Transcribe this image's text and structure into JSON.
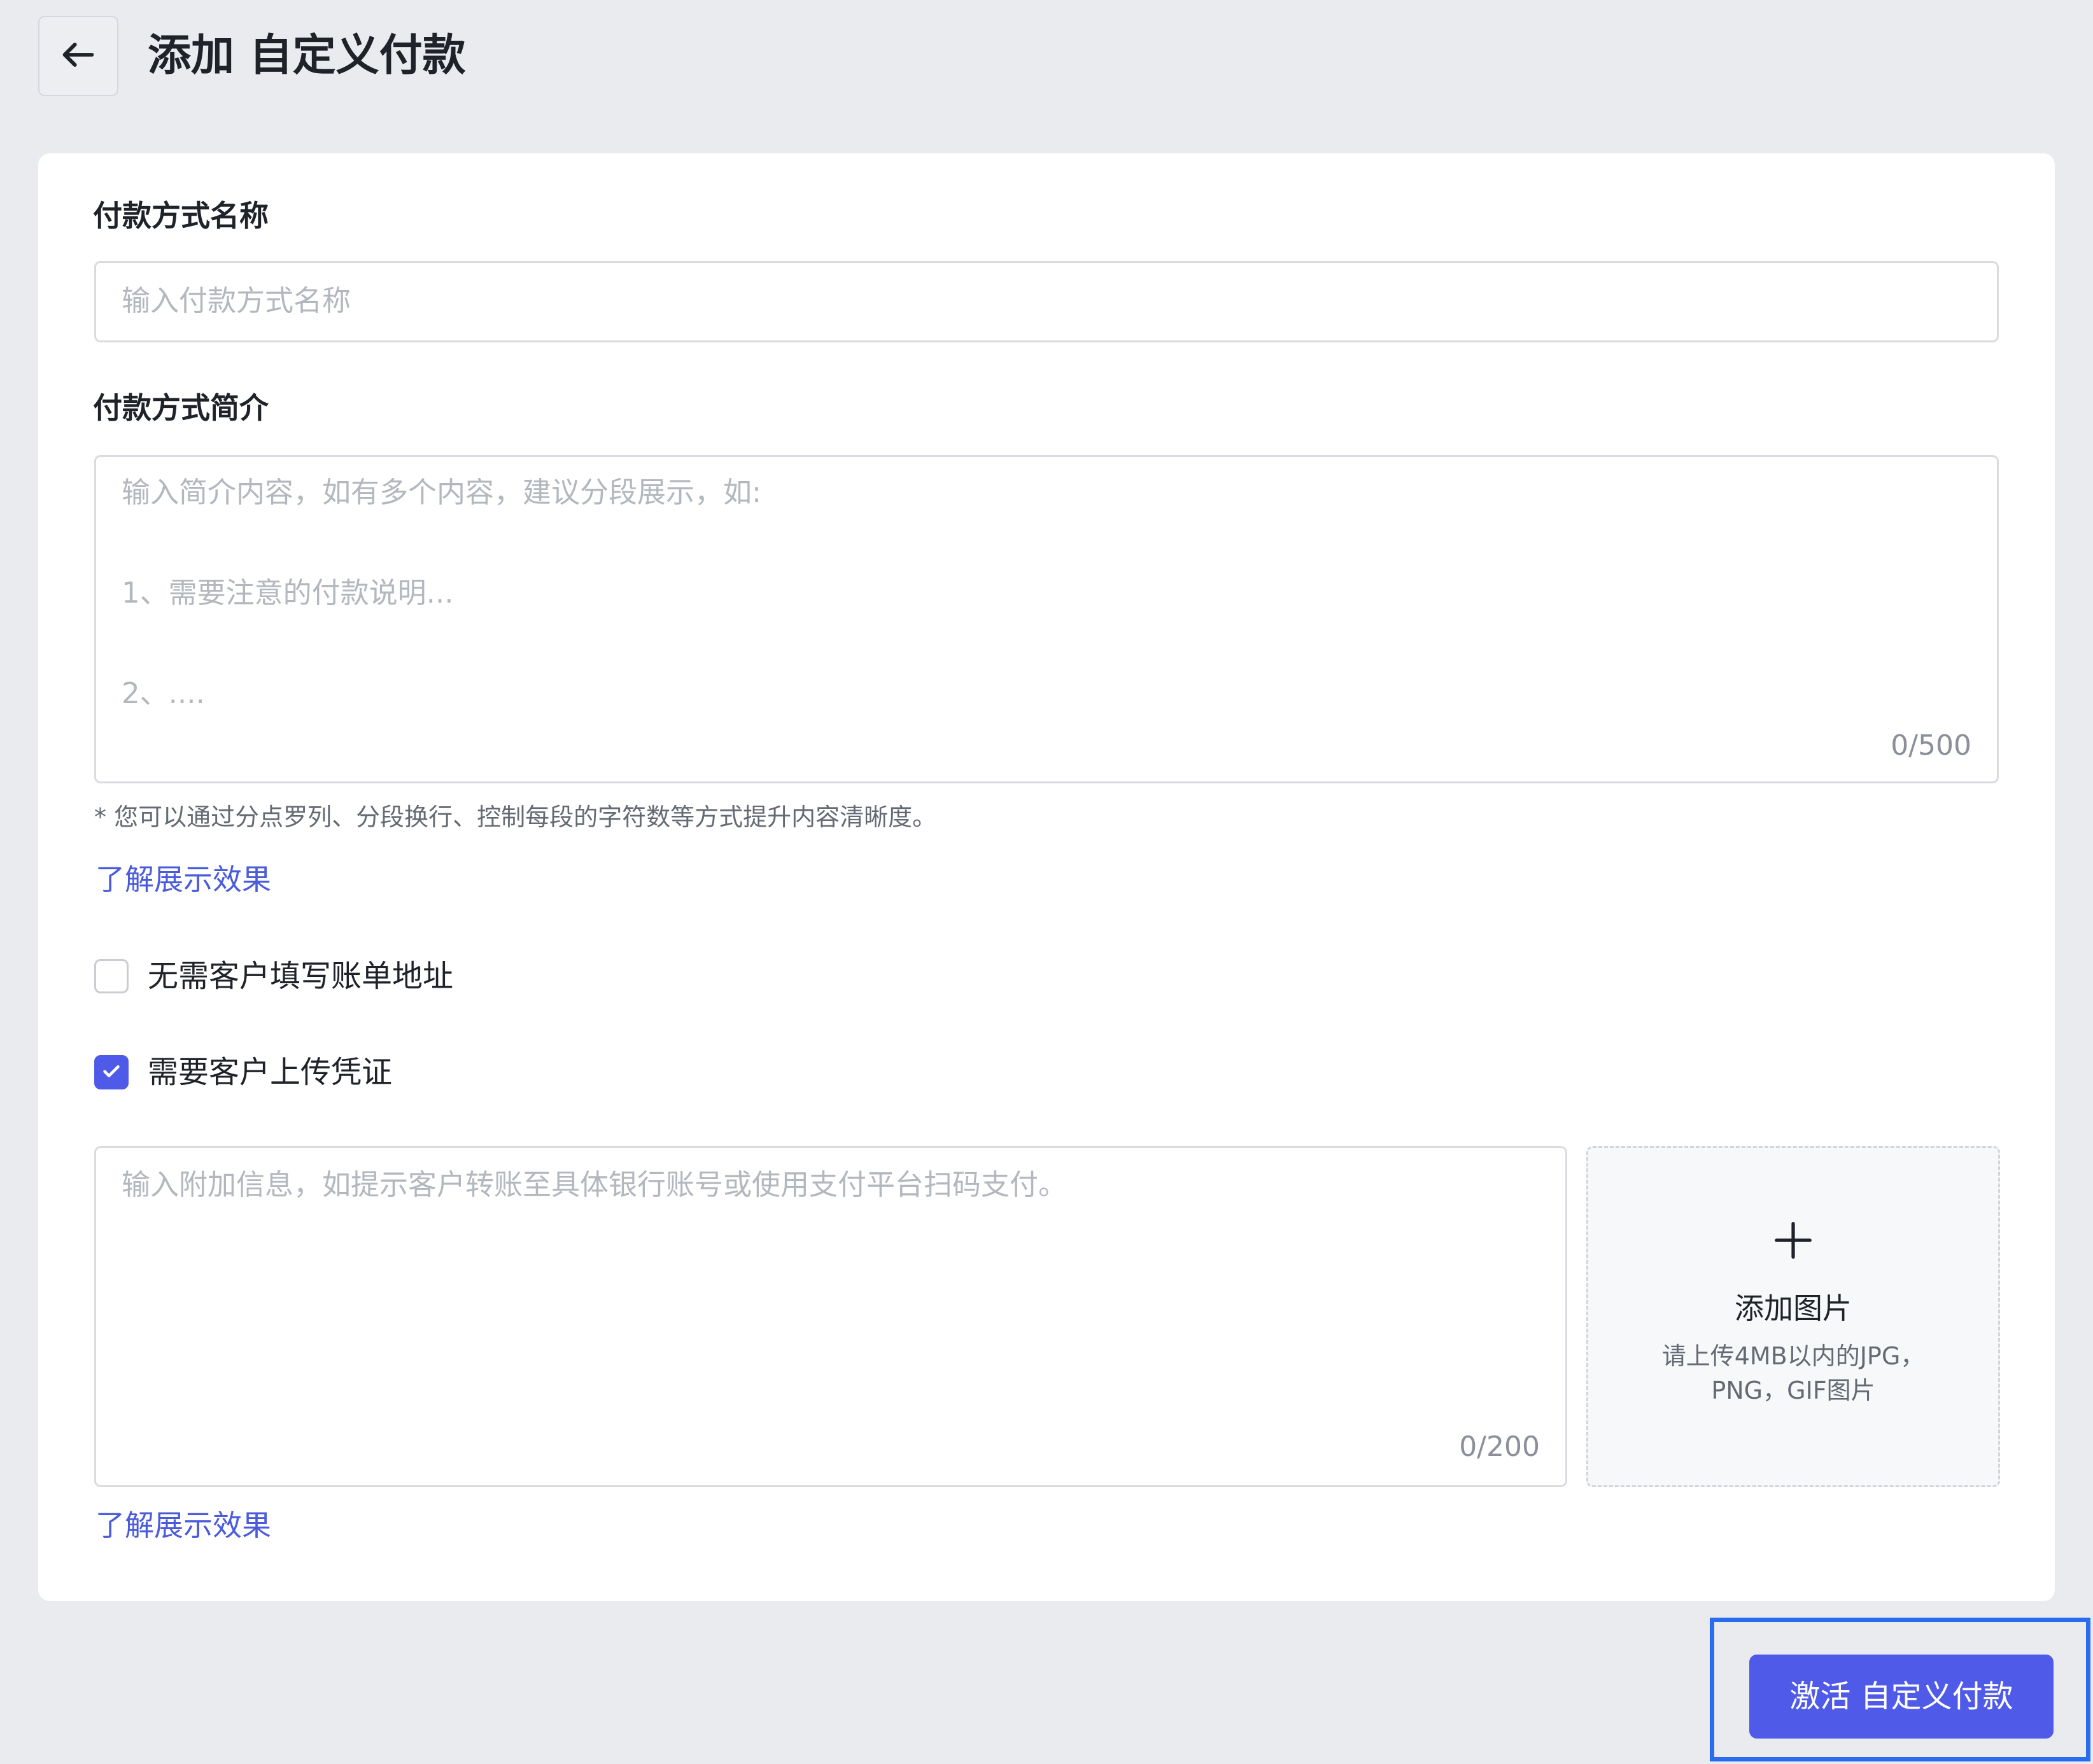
{
  "header": {
    "back_icon": "arrow-left-icon",
    "title": "添加 自定义付款"
  },
  "form": {
    "name_field": {
      "label": "付款方式名称",
      "value": "",
      "placeholder": "输入付款方式名称"
    },
    "intro_field": {
      "label": "付款方式简介",
      "value": "",
      "placeholder_lines": [
        "输入简介内容，如有多个内容，建议分段展示，如:",
        "1、需要注意的付款说明...",
        "2、...."
      ],
      "counter": "0/500"
    },
    "intro_hint": "* 您可以通过分点罗列、分段换行、控制每段的字符数等方式提升内容清晰度。",
    "learn_more_1": "了解展示效果",
    "no_billing_address": {
      "label": "无需客户填写账单地址",
      "checked": false
    },
    "require_voucher": {
      "label": "需要客户上传凭证",
      "checked": true
    },
    "extra_info_field": {
      "value": "",
      "placeholder": "输入附加信息，如提示客户转账至具体银行账号或使用支付平台扫码支付。",
      "counter": "0/200"
    },
    "upload": {
      "icon": "plus-icon",
      "title": "添加图片",
      "desc_line1": "请上传4MB以内的JPG，",
      "desc_line2": "PNG，GIF图片"
    },
    "learn_more_2": "了解展示效果"
  },
  "footer": {
    "activate_label": "激活 自定义付款"
  },
  "colors": {
    "accent": "#4f5be8",
    "link": "#4a5bdc",
    "focus_ring": "#2a6cf0",
    "background": "#e9ebef"
  }
}
